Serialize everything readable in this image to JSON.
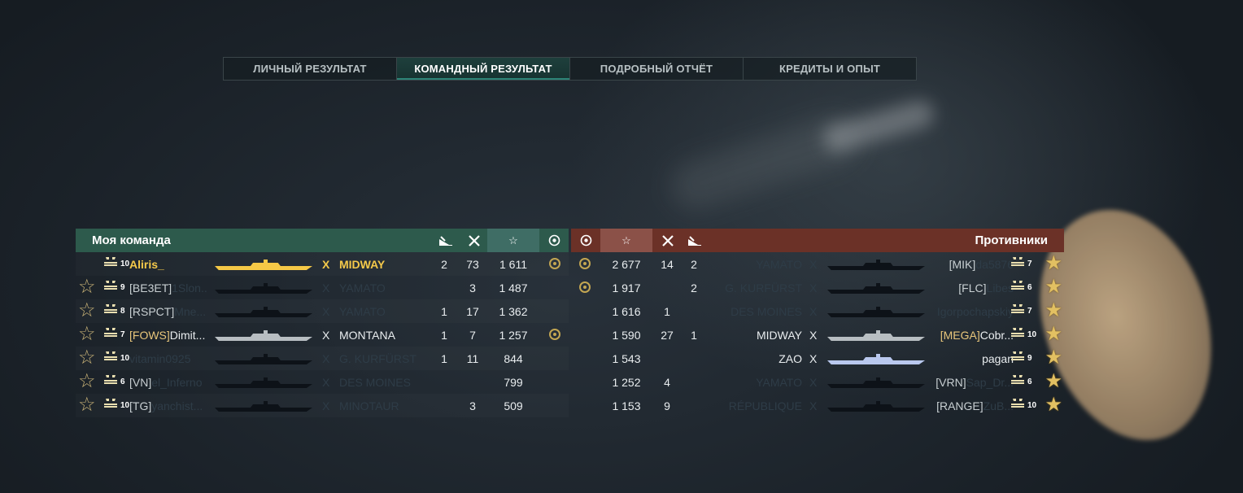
{
  "tabs": [
    {
      "label": "ЛИЧНЫЙ РЕЗУЛЬТАТ",
      "active": false
    },
    {
      "label": "КОМАНДНЫЙ РЕЗУЛЬТАТ",
      "active": true
    },
    {
      "label": "ПОДРОБНЫЙ ОТЧЁТ",
      "active": false
    },
    {
      "label": "КРЕДИТЫ И ОПЫТ",
      "active": false
    }
  ],
  "my_team": {
    "title": "Моя команда",
    "header_icons": [
      "ship-damage-icon",
      "kills-icon",
      "experience-star-icon",
      "ribbon-emblem-icon"
    ],
    "rows": [
      {
        "tier": "10",
        "clan": "",
        "player": "Aliris_",
        "ship_class": "X",
        "ship": "MIDWAY",
        "col1": "2",
        "col2": "73",
        "xp": "1 611",
        "badge": true,
        "state": "self"
      },
      {
        "tier": "9",
        "clan": "[BE3ET]",
        "player": "1Slon...",
        "ship_class": "X",
        "ship": "YAMATO",
        "col1": "",
        "col2": "3",
        "xp": "1 487",
        "badge": false,
        "state": "dead"
      },
      {
        "tier": "8",
        "clan": "[RSPCT]",
        "player": "Mne...",
        "ship_class": "X",
        "ship": "YAMATO",
        "col1": "1",
        "col2": "17",
        "xp": "1 362",
        "badge": false,
        "state": "dead"
      },
      {
        "tier": "7",
        "clan": "[FOWS]",
        "player": "Dimit...",
        "ship_class": "X",
        "ship": "MONTANA",
        "col1": "1",
        "col2": "7",
        "xp": "1 257",
        "badge": true,
        "state": "alive"
      },
      {
        "tier": "10",
        "clan": "",
        "player": "vitamin0925",
        "ship_class": "X",
        "ship": "G. KURFÜRST",
        "col1": "1",
        "col2": "11",
        "xp": "844",
        "badge": false,
        "state": "dead"
      },
      {
        "tier": "6",
        "clan": "[VN]",
        "player": "el_Inferno",
        "ship_class": "X",
        "ship": "DES MOINES",
        "col1": "",
        "col2": "",
        "xp": "799",
        "badge": false,
        "state": "dead"
      },
      {
        "tier": "10",
        "clan": "[TG]",
        "player": "yanchist...",
        "ship_class": "X",
        "ship": "MINOTAUR",
        "col1": "",
        "col2": "3",
        "xp": "509",
        "badge": false,
        "state": "dead"
      }
    ]
  },
  "enemies": {
    "title": "Противники",
    "header_icons": [
      "ribbon-emblem-icon",
      "experience-star-icon",
      "kills-icon",
      "ship-damage-icon"
    ],
    "rows": [
      {
        "badge": true,
        "xp": "2 677",
        "col2": "14",
        "col1": "2",
        "ship": "YAMATO",
        "ship_class": "X",
        "clan": "[MIK]",
        "player": "da5876",
        "tier": "7",
        "state": "dead"
      },
      {
        "badge": true,
        "xp": "1 917",
        "col2": "",
        "col1": "2",
        "ship": "G. KURFÜRST",
        "ship_class": "X",
        "clan": "[FLC]",
        "player": "Libes",
        "tier": "6",
        "state": "dead"
      },
      {
        "badge": false,
        "xp": "1 616",
        "col2": "1",
        "col1": "",
        "ship": "DES MOINES",
        "ship_class": "X",
        "clan": "",
        "player": "Igorpochapskiy",
        "tier": "7",
        "state": "dead"
      },
      {
        "badge": false,
        "xp": "1 590",
        "col2": "27",
        "col1": "1",
        "ship": "MIDWAY",
        "ship_class": "X",
        "clan": "[MEGA]",
        "player": "Cobr...",
        "tier": "10",
        "state": "alive"
      },
      {
        "badge": false,
        "xp": "1 543",
        "col2": "",
        "col1": "",
        "ship": "ZAO",
        "ship_class": "X",
        "clan": "",
        "player": "pagan",
        "tier": "9",
        "state": "alive-light"
      },
      {
        "badge": false,
        "xp": "1 252",
        "col2": "4",
        "col1": "",
        "ship": "YAMATO",
        "ship_class": "X",
        "clan": "[VRN]",
        "player": "Sap_Dr...",
        "tier": "6",
        "state": "dead"
      },
      {
        "badge": false,
        "xp": "1 153",
        "col2": "9",
        "col1": "",
        "ship": "RÉPUBLIQUE",
        "ship_class": "X",
        "clan": "[RANGE]",
        "player": "ZuB...",
        "tier": "10",
        "state": "dead"
      }
    ]
  },
  "colors": {
    "my_team_header": "#2d5a4c",
    "enemy_header": "#6b3127",
    "self_highlight": "#f4c94a",
    "active_tab_accent": "#2c8477"
  }
}
